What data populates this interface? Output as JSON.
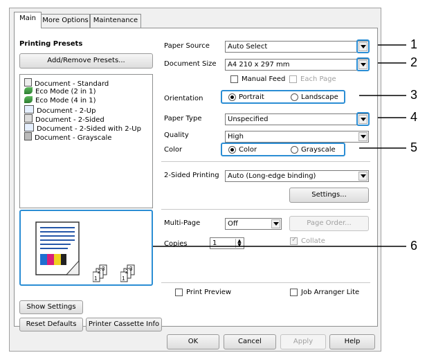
{
  "tabs": [
    {
      "label": "Main"
    },
    {
      "label": "More Options"
    },
    {
      "label": "Maintenance"
    }
  ],
  "presets": {
    "heading": "Printing Presets",
    "add_remove_label": "Add/Remove Presets...",
    "items": [
      {
        "label": "Document - Standard",
        "icon": "document-icon"
      },
      {
        "label": "Eco Mode (2 in 1)",
        "icon": "eco-icon"
      },
      {
        "label": "Eco Mode (4 in 1)",
        "icon": "eco-icon"
      },
      {
        "label": "Document - 2-Up",
        "icon": "two-up-icon"
      },
      {
        "label": "Document - 2-Sided",
        "icon": "two-sided-icon"
      },
      {
        "label": "Document - 2-Sided with 2-Up",
        "icon": "two-sided-two-up-icon"
      },
      {
        "label": "Document - Grayscale",
        "icon": "grayscale-icon"
      }
    ]
  },
  "preview": {
    "page_icons": [
      "collate-pages-icon",
      "collate-pages-icon"
    ],
    "page_numbers": [
      "1",
      "2",
      "3"
    ]
  },
  "fields": {
    "paper_source": {
      "label": "Paper Source",
      "value": "Auto Select"
    },
    "document_size": {
      "label": "Document Size",
      "value": "A4 210 x 297 mm"
    },
    "manual_feed": {
      "label": "Manual Feed",
      "checked": false
    },
    "each_page": {
      "label": "Each Page",
      "checked": false,
      "disabled": true
    },
    "orientation": {
      "label": "Orientation",
      "options": [
        "Portrait",
        "Landscape"
      ],
      "selected": "Portrait"
    },
    "paper_type": {
      "label": "Paper Type",
      "value": "Unspecified"
    },
    "quality": {
      "label": "Quality",
      "value": "High"
    },
    "color": {
      "label": "Color",
      "options": [
        "Color",
        "Grayscale"
      ],
      "selected": "Color"
    },
    "two_sided": {
      "label": "2-Sided Printing",
      "value": "Auto (Long-edge binding)"
    },
    "settings_label": "Settings...",
    "multi_page": {
      "label": "Multi-Page",
      "value": "Off"
    },
    "page_order_label": "Page Order...",
    "copies": {
      "label": "Copies",
      "value": "1"
    },
    "collate": {
      "label": "Collate",
      "checked": true,
      "disabled": true
    },
    "print_preview": {
      "label": "Print Preview",
      "checked": false
    },
    "job_arranger": {
      "label": "Job Arranger Lite",
      "checked": false
    }
  },
  "bottom_buttons": {
    "show_settings": "Show Settings",
    "reset_defaults": "Reset Defaults",
    "cassette_info": "Printer Cassette Info"
  },
  "dialog_buttons": {
    "ok": "OK",
    "cancel": "Cancel",
    "apply": "Apply",
    "help": "Help"
  },
  "callouts": [
    "1",
    "2",
    "3",
    "4",
    "5",
    "6"
  ],
  "colors": {
    "highlight": "#2a8dd4",
    "window_bg": "#f0f0f0",
    "callout_line": "#000000"
  }
}
